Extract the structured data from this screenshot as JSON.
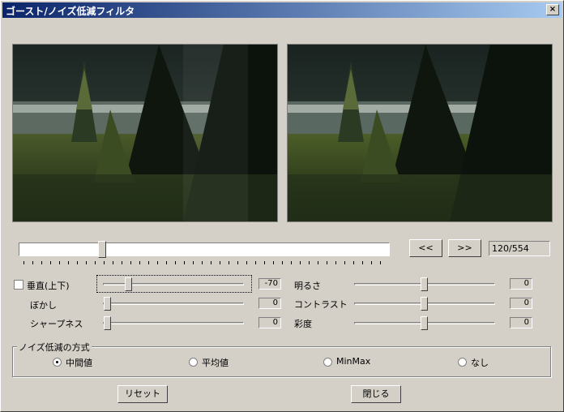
{
  "window": {
    "title": "ゴースト/ノイズ低減フィルタ",
    "close_label": "×"
  },
  "playback": {
    "prev_label": "<<",
    "next_label": ">>",
    "frame_counter": "120/554",
    "position": 0.217
  },
  "vertical": {
    "label": "垂直(上下)",
    "checked": false,
    "value": "-70"
  },
  "blur": {
    "label": "ぼかし",
    "value": "0"
  },
  "sharpness": {
    "label": "シャープネス",
    "value": "0"
  },
  "brightness": {
    "label": "明るさ",
    "value": "0"
  },
  "contrast": {
    "label": "コントラスト",
    "value": "0"
  },
  "saturation": {
    "label": "彩度",
    "value": "0"
  },
  "noise_method": {
    "legend": "ノイズ低減の方式",
    "options": [
      {
        "label": "中間値",
        "selected": true
      },
      {
        "label": "平均値",
        "selected": false
      },
      {
        "label": "MinMax",
        "selected": false
      },
      {
        "label": "なし",
        "selected": false
      }
    ]
  },
  "buttons": {
    "reset_label": "リセット",
    "close_label": "閉じる"
  }
}
